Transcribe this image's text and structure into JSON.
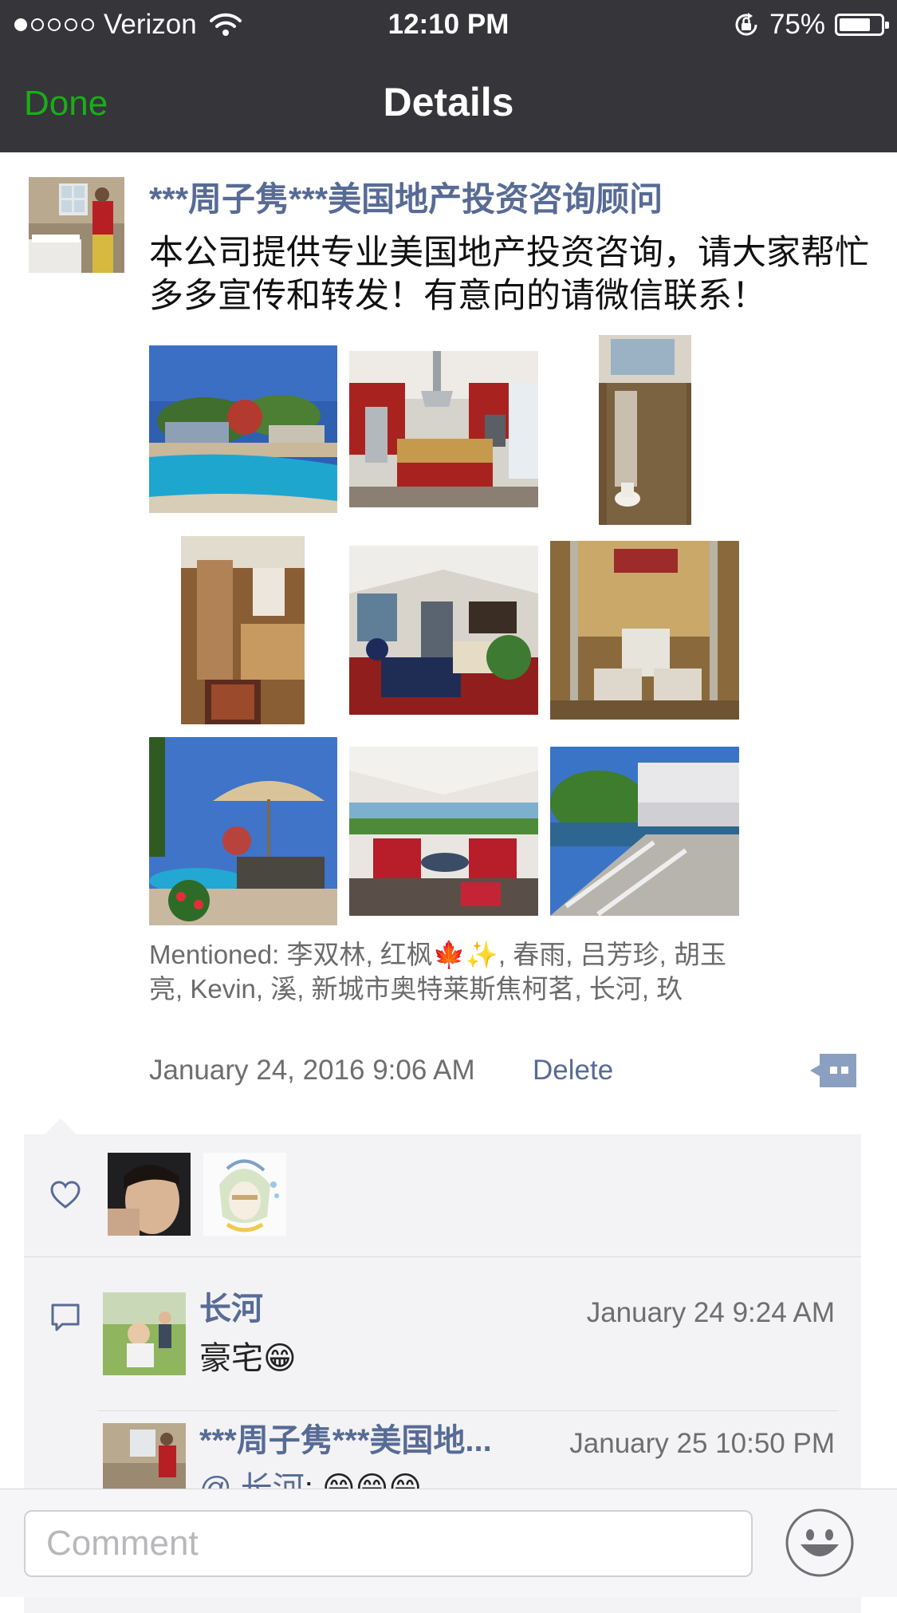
{
  "status_bar": {
    "carrier": "Verizon",
    "time": "12:10 PM",
    "battery": "75%"
  },
  "nav": {
    "done_label": "Done",
    "title": "Details"
  },
  "post": {
    "author": "***周子隽***美国地产投资咨询顾问",
    "text": "本公司提供专业美国地产投资咨询，请大家帮忙多多宣传和转发！有意向的请微信联系！",
    "mentioned": "Mentioned: 李双林, 红枫🍁✨, 春雨, 吕芳珍, 胡玉亮, Kevin, 溪, 新城市奥特莱斯焦柯茗, 长河, 玖",
    "timestamp": "January 24, 2016 9:06 AM",
    "delete_label": "Delete",
    "photos": [
      "pool",
      "kitchen",
      "bathroom-skylight",
      "bathroom",
      "living-room",
      "bedroom",
      "patio-umbrella",
      "covered-patio",
      "deck"
    ]
  },
  "comments": [
    {
      "author": "长河",
      "time": "January 24 9:24 AM",
      "text": "豪宅😁"
    },
    {
      "author": "***周子隽***美国地...",
      "time": "January 25 10:50 PM",
      "mention": "@ 长河",
      "text": ": 😁😁😁"
    }
  ],
  "input": {
    "placeholder": "Comment"
  },
  "colors": {
    "nav_bar": "#35353a",
    "done_green": "#1aad19",
    "link_blue": "#576b95",
    "panel_bg": "#f3f3f5"
  }
}
